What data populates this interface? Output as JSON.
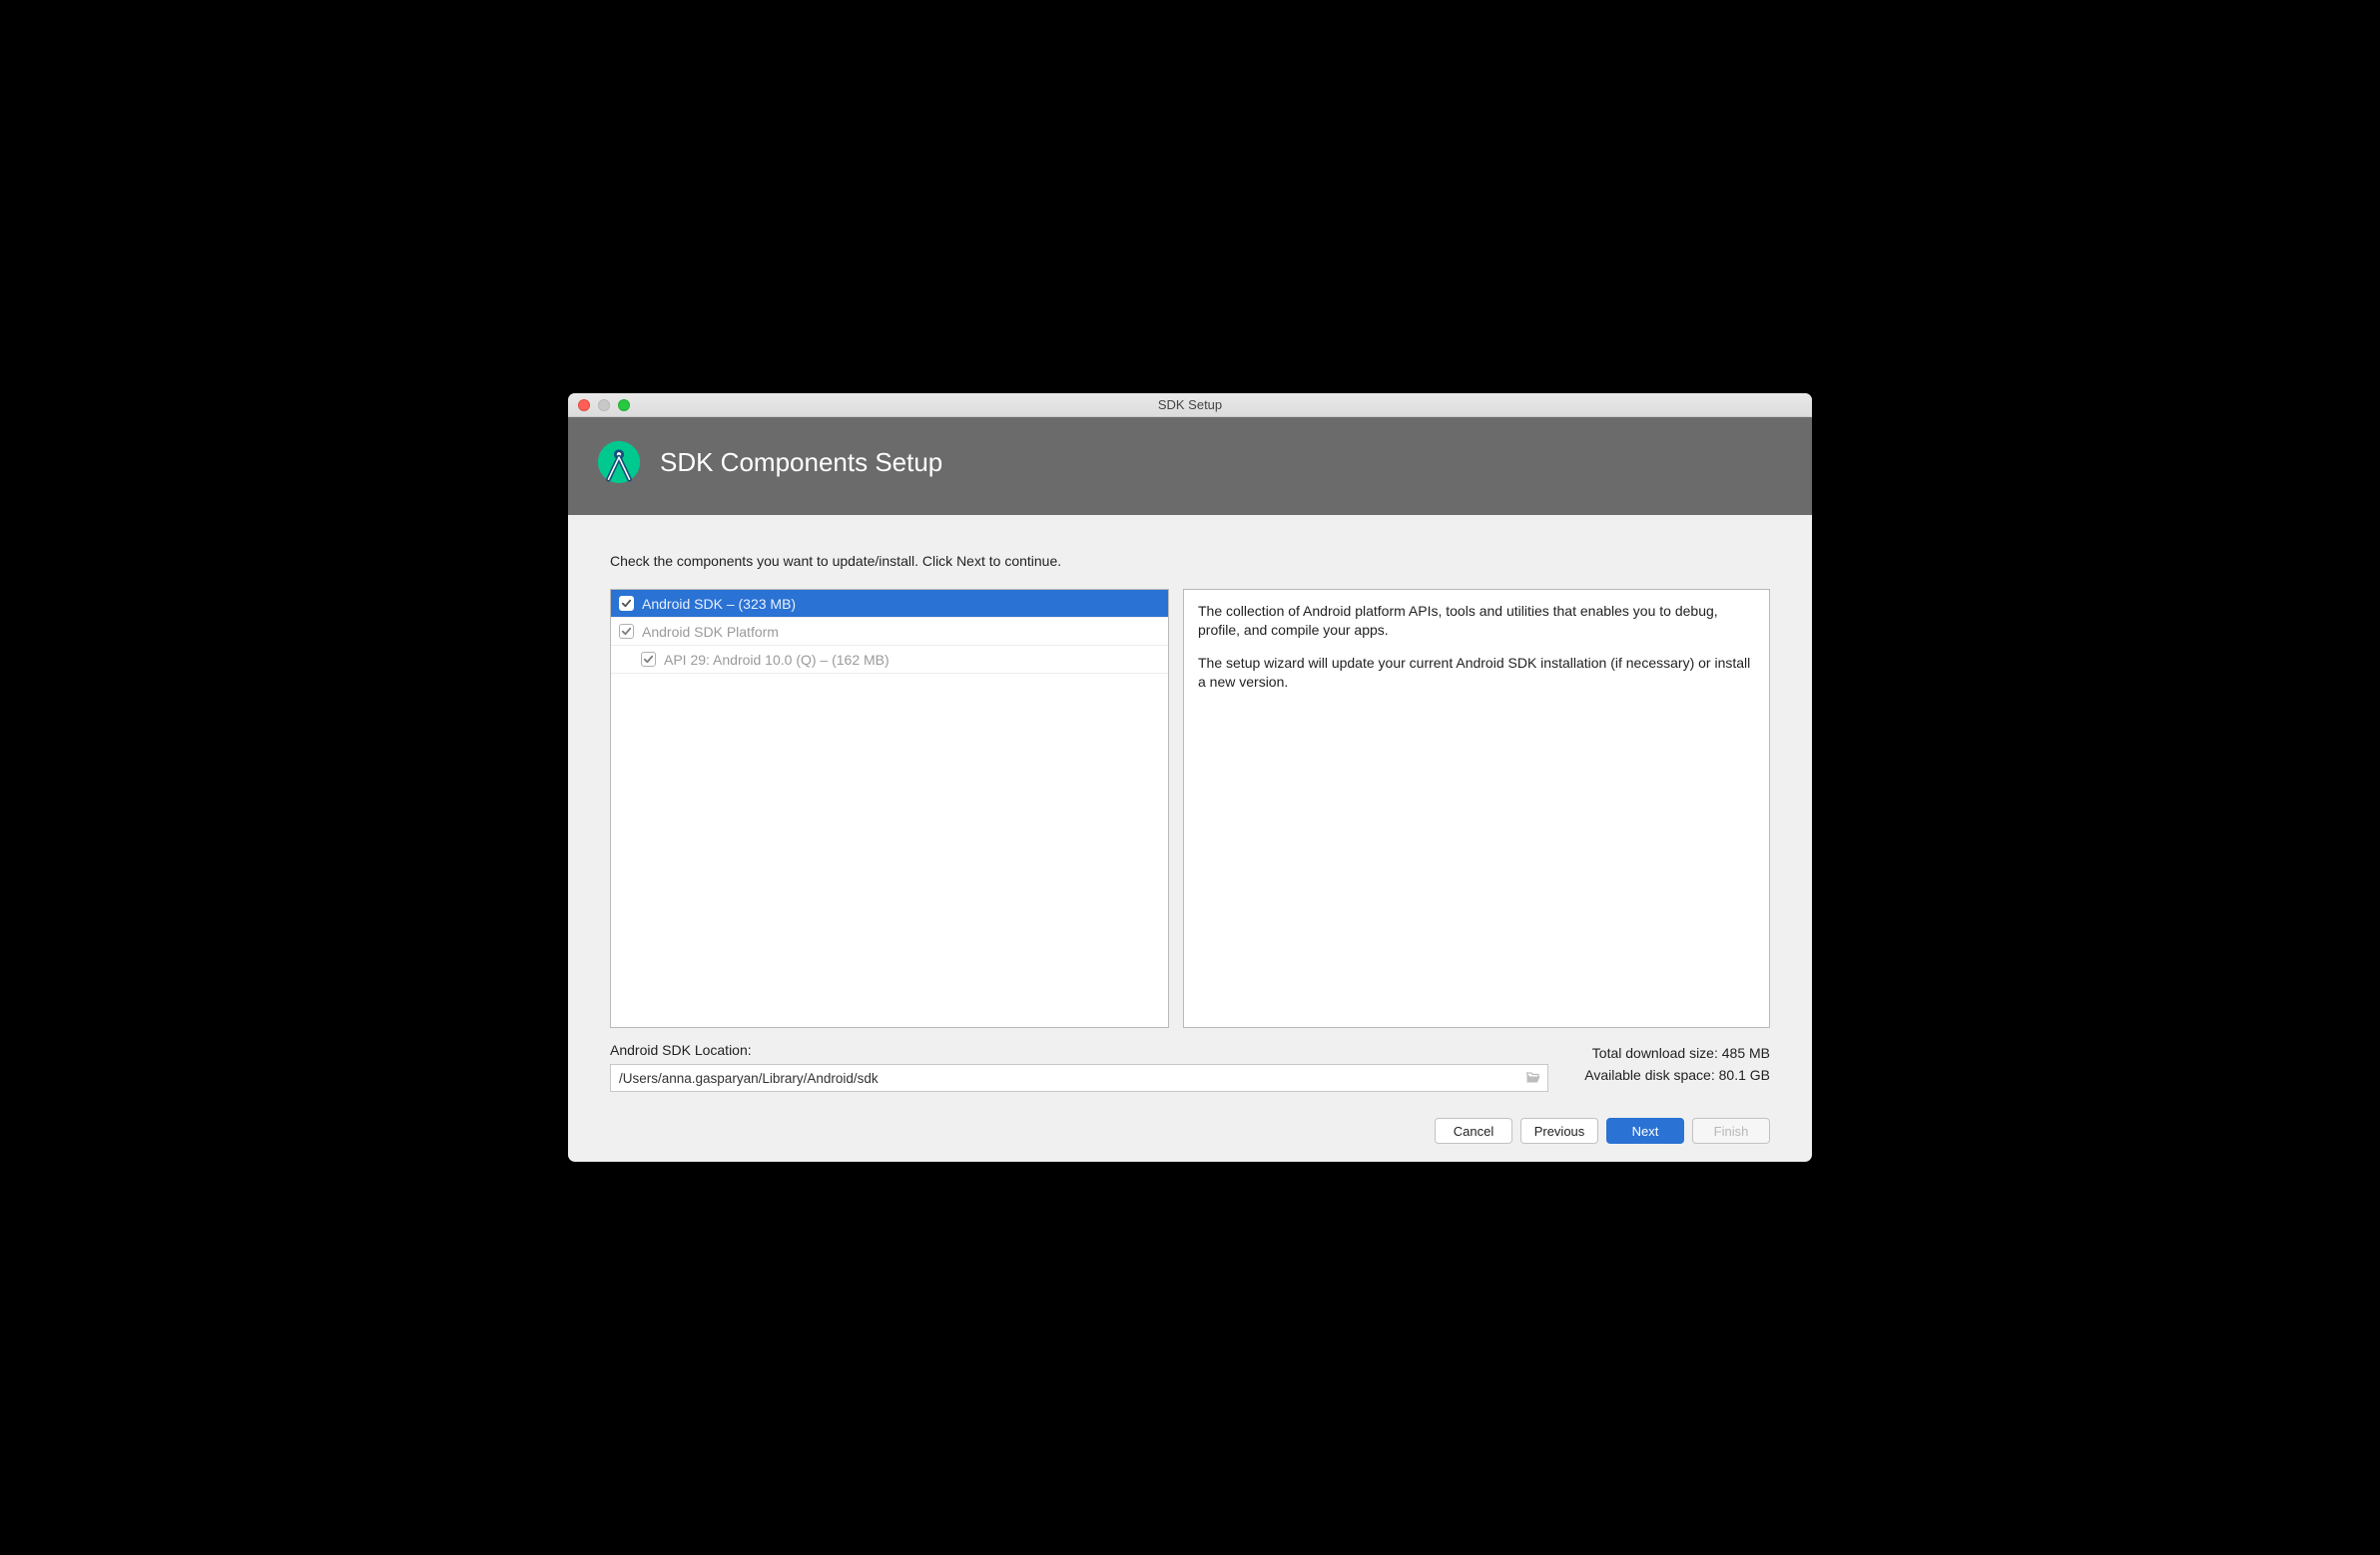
{
  "window": {
    "title": "SDK Setup"
  },
  "header": {
    "heading": "SDK Components Setup"
  },
  "instruction": "Check the components you want to update/install. Click Next to continue.",
  "components": {
    "items": [
      {
        "label": "Android SDK – (323 MB)",
        "selected": true,
        "indent": 0,
        "disabled": false
      },
      {
        "label": "Android SDK Platform",
        "selected": false,
        "indent": 0,
        "disabled": true
      },
      {
        "label": "API 29: Android 10.0 (Q) – (162 MB)",
        "selected": false,
        "indent": 1,
        "disabled": true
      }
    ]
  },
  "description": {
    "p1": "The collection of Android platform APIs, tools and utilities that enables you to debug, profile, and compile your apps.",
    "p2": "The setup wizard will update your current Android SDK installation (if necessary) or install a new version."
  },
  "location": {
    "label": "Android SDK Location:",
    "value": "/Users/anna.gasparyan/Library/Android/sdk"
  },
  "stats": {
    "download": "Total download size: 485 MB",
    "disk": "Available disk space: 80.1 GB"
  },
  "buttons": {
    "cancel": "Cancel",
    "previous": "Previous",
    "next": "Next",
    "finish": "Finish"
  }
}
